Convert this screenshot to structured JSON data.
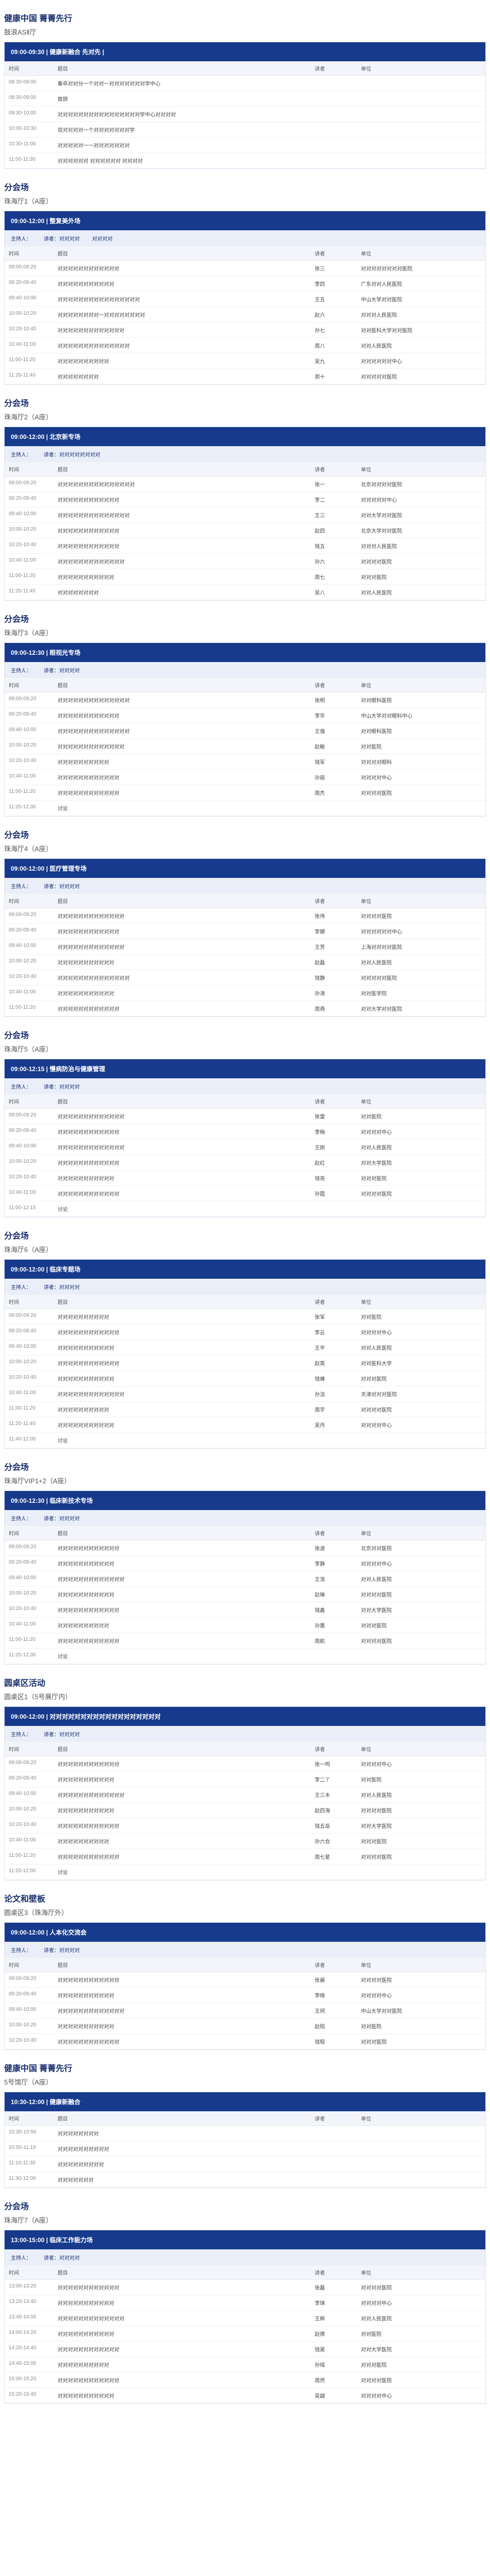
{
  "s1": {
    "title": "健康中国 菁菁先行",
    "sub": "鼓浪ASⅡ厅",
    "head": "09:00-09:30 | 健康新融合 先对先 | ",
    "cols": [
      "时间",
      "题目",
      "讲者",
      "单位"
    ],
    "rows": [
      [
        "08:30-09:00",
        "秦卒对对分一个对对一对对对对对对对学中心",
        "",
        ""
      ],
      [
        "08:30-09:00",
        "致辞",
        "",
        ""
      ],
      [
        "09:30-10:00",
        "对对对对对对对对对对对对对对对对学中心对对对对",
        "",
        ""
      ],
      [
        "10:00-10:30",
        "双对对对对一个对对对对对对对学",
        "",
        ""
      ],
      [
        "10:30-11:00",
        "对对对对对一一对对对对对对对",
        "",
        ""
      ],
      [
        "11:00-11:30",
        "对对对对对对 对对对对对对 对对对对",
        "",
        ""
      ]
    ]
  },
  "s2": {
    "title": "分会场",
    "sub": "珠海厅1（A座）",
    "head": "09:00-12:00 | 整复美外场",
    "chairs": [
      "主持人：",
      "讲者：对对对对",
      "对对对对"
    ],
    "cols": [
      "时间",
      "题目",
      "讲者",
      "单位"
    ],
    "rows": [
      [
        "09:00-09:20",
        "对对对对对对对对对对对对",
        "张三",
        "对对对对对对对对医院"
      ],
      [
        "09:20-09:40",
        "对对对对对对对对对对对",
        "李四",
        "广东对对人民医院"
      ],
      [
        "09:40-10:00",
        "对对对对对对对对对对对对对对对对",
        "王五",
        "中山大学对对医院"
      ],
      [
        "10:00-10:20",
        "对对对对对对对对一对对对对对对对对",
        "赵六",
        "对对对人民医院"
      ],
      [
        "10:20-10:40",
        "对对对对对对对对对对对对对",
        "孙七",
        "对对医科大学对对医院"
      ],
      [
        "10:40-11:00",
        "对对对对对对对对对对对对对对",
        "周八",
        "对对人民医院"
      ],
      [
        "11:00-11:20",
        "对对对对对对对对对对",
        "吴九",
        "对对对对对对中心"
      ],
      [
        "11:20-11:40",
        "对对对对对对对对",
        "郑十",
        "对对对对对医院"
      ]
    ]
  },
  "s3": {
    "title": "分会场",
    "sub": "珠海厅2（A座）",
    "head": "09:00-12:00 | 北京新专场",
    "chairs": [
      "主持人：",
      "讲者：对对对对对对对对"
    ],
    "cols": [
      "时间",
      "题目",
      "讲者",
      "单位"
    ],
    "rows": [
      [
        "09:00-09:20",
        "对对对对对对对对对对对对对对对",
        "张一",
        "北京对对对对医院"
      ],
      [
        "09:20-09:40",
        "对对对对对对对对对对对对",
        "李二",
        "对对对对对中心"
      ],
      [
        "09:40-10:00",
        "对对对对对对对对对对对对对对",
        "王三",
        "对对大学对对医院"
      ],
      [
        "10:00-10:20",
        "对对对对对对对对对对对对",
        "赵四",
        "北京大学对对医院"
      ],
      [
        "10:20-10:40",
        "对对对对对对对对对对对对",
        "钱五",
        "对对对人民医院"
      ],
      [
        "10:40-11:00",
        "对对对对对对对对对对对对对",
        "孙六",
        "对对对对医院"
      ],
      [
        "11:00-11:20",
        "对对对对对对对对对对对",
        "周七",
        "对对对医院"
      ],
      [
        "11:20-11:40",
        "对对对对对对对对",
        "吴八",
        "对对人民医院"
      ]
    ]
  },
  "s4": {
    "title": "分会场",
    "sub": "珠海厅3（A座）",
    "head": "09:00-12:30 | 眼视光专场",
    "chairs": [
      "主持人：",
      "讲者：对对对对"
    ],
    "cols": [
      "时间",
      "题目",
      "讲者",
      "单位"
    ],
    "rows": [
      [
        "09:00-09:20",
        "对对对对对对对对对对对对对对",
        "张明",
        "对对眼科医院"
      ],
      [
        "09:20-09:40",
        "对对对对对对对对对对对对",
        "李华",
        "中山大学对对眼科中心"
      ],
      [
        "09:40-10:00",
        "对对对对对对对对对对对对对对",
        "王强",
        "对对眼科医院"
      ],
      [
        "10:00-10:20",
        "对对对对对对对对对对对对对",
        "赵敏",
        "对对医院"
      ],
      [
        "10:20-10:40",
        "对对对对对对对对对对",
        "钱军",
        "对对对对眼科"
      ],
      [
        "10:40-11:00",
        "对对对对对对对对对对对对",
        "孙丽",
        "对对对对中心"
      ],
      [
        "11:00-11:20",
        "对对对对对对对对对对对对",
        "周杰",
        "对对对对医院"
      ],
      [
        "11:20-12:30",
        "讨论",
        "",
        ""
      ]
    ]
  },
  "s5": {
    "title": "分会场",
    "sub": "珠海厅4（A座）",
    "head": "09:00-12:00 | 医疗管理专场",
    "chairs": [
      "主持人：",
      "讲者：对对对对"
    ],
    "cols": [
      "时间",
      "题目",
      "讲者",
      "单位"
    ],
    "rows": [
      [
        "09:00-09:20",
        "对对对对对对对对对对对对对",
        "张伟",
        "对对对对医院"
      ],
      [
        "09:20-09:40",
        "对对对对对对对对对对对对",
        "李娜",
        "对对对对对对中心"
      ],
      [
        "09:40-10:00",
        "对对对对对对对对对对对对对",
        "王芳",
        "上海对对对对医院"
      ],
      [
        "10:00-10:20",
        "对对对对对对对对对对对",
        "赵磊",
        "对对人民医院"
      ],
      [
        "10:20-10:40",
        "对对对对对对对对对对对对对对",
        "钱静",
        "对对对对对医院"
      ],
      [
        "10:40-11:00",
        "对对对对对对对对对对对",
        "孙涛",
        "对对医学院"
      ],
      [
        "11:00-11:20",
        "对对对对对对对对对对对对",
        "周燕",
        "对对大学对对医院"
      ]
    ]
  },
  "s6": {
    "title": "分会场",
    "sub": "珠海厅5（A座）",
    "head": "09:00-12:15 | 慢病防治与健康管理",
    "chairs": [
      "主持人：",
      "讲者：对对对对"
    ],
    "cols": [
      "时间",
      "题目",
      "讲者",
      "单位"
    ],
    "rows": [
      [
        "09:00-09:20",
        "对对对对对对对对对对对对对",
        "张雷",
        "对对医院"
      ],
      [
        "09:20-09:40",
        "对对对对对对对对对对对对",
        "李梅",
        "对对对对中心"
      ],
      [
        "09:40-10:00",
        "对对对对对对对对对对对对对",
        "王刚",
        "对对人民医院"
      ],
      [
        "10:00-10:20",
        "对对对对对对对对对对对对",
        "赵红",
        "对对大学医院"
      ],
      [
        "10:20-10:40",
        "对对对对对对对对对对对",
        "钱亮",
        "对对对医院"
      ],
      [
        "10:40-11:00",
        "对对对对对对对对对对对对",
        "孙霞",
        "对对对对医院"
      ],
      [
        "11:00-12:15",
        "讨论",
        "",
        ""
      ]
    ]
  },
  "s7": {
    "title": "分会场",
    "sub": "珠海厅6（A座）",
    "head": "09:00-12:00 | 临床专题场",
    "chairs": [
      "主持人：",
      "讲者：对对对对"
    ],
    "cols": [
      "时间",
      "题目",
      "讲者",
      "单位"
    ],
    "rows": [
      [
        "09:00-09:20",
        "对对对对对对对对对对",
        "张军",
        "对对医院"
      ],
      [
        "09:20-09:40",
        "对对对对对对对对对对对对",
        "李云",
        "对对对对中心"
      ],
      [
        "09:40-10:00",
        "对对对对对对对对对对对",
        "王平",
        "对对人民医院"
      ],
      [
        "10:00-10:20",
        "对对对对对对对对对对对对",
        "赵英",
        "对对医科大学"
      ],
      [
        "10:20-10:40",
        "对对对对对对对对对对对",
        "钱峰",
        "对对对医院"
      ],
      [
        "10:40-11:00",
        "对对对对对对对对对对对对对",
        "孙洁",
        "天津对对对医院"
      ],
      [
        "11:00-11:20",
        "对对对对对对对对对对",
        "周宇",
        "对对对对医院"
      ],
      [
        "11:20-11:40",
        "对对对对对对对对对对对",
        "吴丹",
        "对对对对中心"
      ],
      [
        "11:40-12:00",
        "讨论",
        "",
        ""
      ]
    ]
  },
  "s8": {
    "title": "分会场",
    "sub": "珠海厅VIP1+2（A座）",
    "head": "09:00-12:30 | 临床新技术专场",
    "chairs": [
      "主持人：",
      "讲者：对对对对"
    ],
    "cols": [
      "时间",
      "题目",
      "讲者",
      "单位"
    ],
    "rows": [
      [
        "09:00-09:20",
        "对对对对对对对对对对对对",
        "张波",
        "北京对对医院"
      ],
      [
        "09:20-09:40",
        "对对对对对对对对对对对",
        "李静",
        "对对对对中心"
      ],
      [
        "09:40-10:00",
        "对对对对对对对对对对对对对",
        "王浩",
        "对对人民医院"
      ],
      [
        "10:00-10:20",
        "对对对对对对对对对对对",
        "赵琳",
        "对对对对医院"
      ],
      [
        "10:20-10:40",
        "对对对对对对对对对对对对",
        "钱鑫",
        "对对大学医院"
      ],
      [
        "10:40-11:00",
        "对对对对对对对对对对",
        "孙蕾",
        "对对对医院"
      ],
      [
        "11:00-11:20",
        "对对对对对对对对对对对对",
        "周航",
        "对对对对医院"
      ],
      [
        "11:20-12:30",
        "讨论",
        "",
        ""
      ]
    ]
  },
  "s9": {
    "title": "圆桌区活动",
    "sub": "圆桌区1（5号展厅内）",
    "head": "09:00-12:00 | 对对对对对对对对对对对对对对对对对对",
    "chairs": [
      "主持人：",
      "讲者：对对对对"
    ],
    "cols": [
      "时间",
      "题目",
      "讲者",
      "单位"
    ],
    "rows": [
      [
        "09:00-09:20",
        "对对对对对对对对对对对对",
        "张一鸣",
        "对对对对中心"
      ],
      [
        "09:20-09:40",
        "对对对对对对对对对对对",
        "李二丫",
        "对对医院"
      ],
      [
        "09:40-10:00",
        "对对对对对对对对对对对对对",
        "王三木",
        "对对人民医院"
      ],
      [
        "10:00-10:20",
        "对对对对对对对对对对对",
        "赵四海",
        "对对对对医院"
      ],
      [
        "10:20-10:40",
        "对对对对对对对对对对对对",
        "钱五岳",
        "对对大学医院"
      ],
      [
        "10:40-11:00",
        "对对对对对对对对对对",
        "孙六合",
        "对对对医院"
      ],
      [
        "11:00-11:20",
        "对对对对对对对对对对对对",
        "周七星",
        "对对对对医院"
      ],
      [
        "11:20-12:00",
        "讨论",
        "",
        ""
      ]
    ]
  },
  "s10": {
    "title": "论文和壁板",
    "sub": "圆桌区3（珠海厅外）",
    "head": "09:00-12:00 | 人本化交流会",
    "chairs": [
      "主持人：",
      "讲者：对对对对"
    ],
    "cols": [
      "时间",
      "题目",
      "讲者",
      "单位"
    ],
    "rows": [
      [
        "09:00-09:20",
        "对对对对对对对对对对对对",
        "张晨",
        "对对对对医院"
      ],
      [
        "09:20-09:40",
        "对对对对对对对对对对对",
        "李晓",
        "对对对对中心"
      ],
      [
        "09:40-10:00",
        "对对对对对对对对对对对对对",
        "王珂",
        "中山大学对对医院"
      ],
      [
        "10:00-10:20",
        "对对对对对对对对对对对",
        "赵阳",
        "对对医院"
      ],
      [
        "10:20-10:40",
        "对对对对对对对对对对对对",
        "钱程",
        "对对对医院"
      ]
    ]
  },
  "s11": {
    "title": "健康中国 菁菁先行",
    "sub": "5号馆厅（A座）",
    "head": "10:30-12:00 | 健康新融合",
    "cols": [
      "时间",
      "题目",
      "讲者",
      "单位"
    ],
    "rows": [
      [
        "10:30-10:50",
        "对对对对对对对对",
        "",
        ""
      ],
      [
        "10:50-11:10",
        "对对对对对对对对对对",
        "",
        ""
      ],
      [
        "11:10-11:30",
        "对对对对对对对对对",
        "",
        ""
      ],
      [
        "11:30-12:00",
        "对对对对对对对",
        "",
        ""
      ]
    ]
  },
  "s12": {
    "title": "分会场",
    "sub": "珠海厅7（A座）",
    "head": "13:00-15:00 | 临床工作能力场",
    "chairs": [
      "主持人：",
      "讲者：对对对对"
    ],
    "cols": [
      "时间",
      "题目",
      "讲者",
      "单位"
    ],
    "rows": [
      [
        "13:00-13:20",
        "对对对对对对对对对对对对",
        "张磊",
        "对对对对医院"
      ],
      [
        "13:20-13:40",
        "对对对对对对对对对对对",
        "李琪",
        "对对对对中心"
      ],
      [
        "13:40-14:00",
        "对对对对对对对对对对对对对",
        "王辉",
        "对对人民医院"
      ],
      [
        "14:00-14:20",
        "对对对对对对对对对对对",
        "赵倩",
        "对对医院"
      ],
      [
        "14:20-14:40",
        "对对对对对对对对对对对对",
        "钱昊",
        "对对大学医院"
      ],
      [
        "14:40-15:00",
        "对对对对对对对对对对",
        "孙瑶",
        "对对对医院"
      ],
      [
        "15:00-15:20",
        "对对对对对对对对对对对对",
        "周然",
        "对对对对医院"
      ],
      [
        "15:20-15:40",
        "对对对对对对对对对对对",
        "吴越",
        "对对对对中心"
      ]
    ]
  }
}
